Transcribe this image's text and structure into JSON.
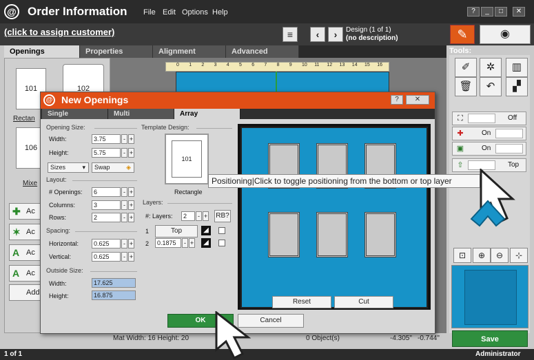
{
  "app": {
    "title": "Order Information",
    "menu": [
      "File",
      "Edit",
      "Options",
      "Help"
    ],
    "window_buttons": [
      "?",
      "_",
      "□",
      "✕"
    ]
  },
  "header": {
    "assign_link": "(click to assign customer)",
    "design_line1": "Design  (1 of 1)",
    "design_line2": "(no description)"
  },
  "main_tabs": [
    "Openings",
    "Properties",
    "Alignment",
    "Advanced"
  ],
  "tools_label": "Tools:",
  "left_panel": {
    "thumb1": "101",
    "thumb2": "102",
    "thumb3": "106",
    "label_rect": "Rectan",
    "label_mixed": "Mixe",
    "btn1": "Ac",
    "btn2": "Ac",
    "btn3": "Ac",
    "btn4": "Ac",
    "btn5": "Add"
  },
  "ruler_ticks": [
    "0",
    "1",
    "2",
    "3",
    "4",
    "5",
    "6",
    "7",
    "8",
    "9",
    "10",
    "11",
    "12",
    "13",
    "14",
    "15",
    "16"
  ],
  "dialog": {
    "title": "New Openings",
    "tabs": [
      "Single",
      "Multi",
      "Array"
    ],
    "opening_size": {
      "group": "Opening Size:",
      "width_label": "Width:",
      "width": "3.75",
      "height_label": "Height:",
      "height": "5.75",
      "sizes": "Sizes",
      "swap": "Swap"
    },
    "layout": {
      "group": "Layout:",
      "openings_label": "# Openings:",
      "openings": "6",
      "columns_label": "Columns:",
      "columns": "3",
      "rows_label": "Rows:",
      "rows": "2"
    },
    "spacing": {
      "group": "Spacing:",
      "horizontal_label": "Horizontal:",
      "horizontal": "0.625",
      "vertical_label": "Vertical:",
      "vertical": "0.625"
    },
    "outside_size": {
      "group": "Outside Size:",
      "width_label": "Width:",
      "width": "17.625",
      "height_label": "Height:",
      "height": "16.875"
    },
    "template": {
      "group": "Template Design:",
      "thumb": "101",
      "name": "Rectangle"
    },
    "layers": {
      "group": "Layers:",
      "count_label": "#: Layers:",
      "count": "2",
      "rb_button": "RB?",
      "row1_num": "1",
      "row1_value": "Top",
      "row2_num": "2",
      "row2_value": "0.1875"
    },
    "reset_label": "Reset",
    "cut_label": "Cut",
    "ok_label": "OK",
    "cancel_label": "Cancel"
  },
  "tooltip": "Positioning|Click to toggle positioning from the bottom or top layer",
  "right_panel": {
    "toggle1": "Off",
    "toggle2": "On",
    "toggle3": "On",
    "toggle4": "Top",
    "save_label": "Save"
  },
  "info_bar": {
    "mat": "Mat  Width: 16  Height: 20",
    "objects": "0 Object(s)",
    "x": "-4.305\"",
    "y": "-0.744\""
  },
  "status": {
    "page": "1 of 1",
    "user": "Administrator"
  },
  "colors": {
    "mat_blue": "#1793c8",
    "accent_orange": "#e04e16",
    "ok_green": "#2f8f3e"
  }
}
